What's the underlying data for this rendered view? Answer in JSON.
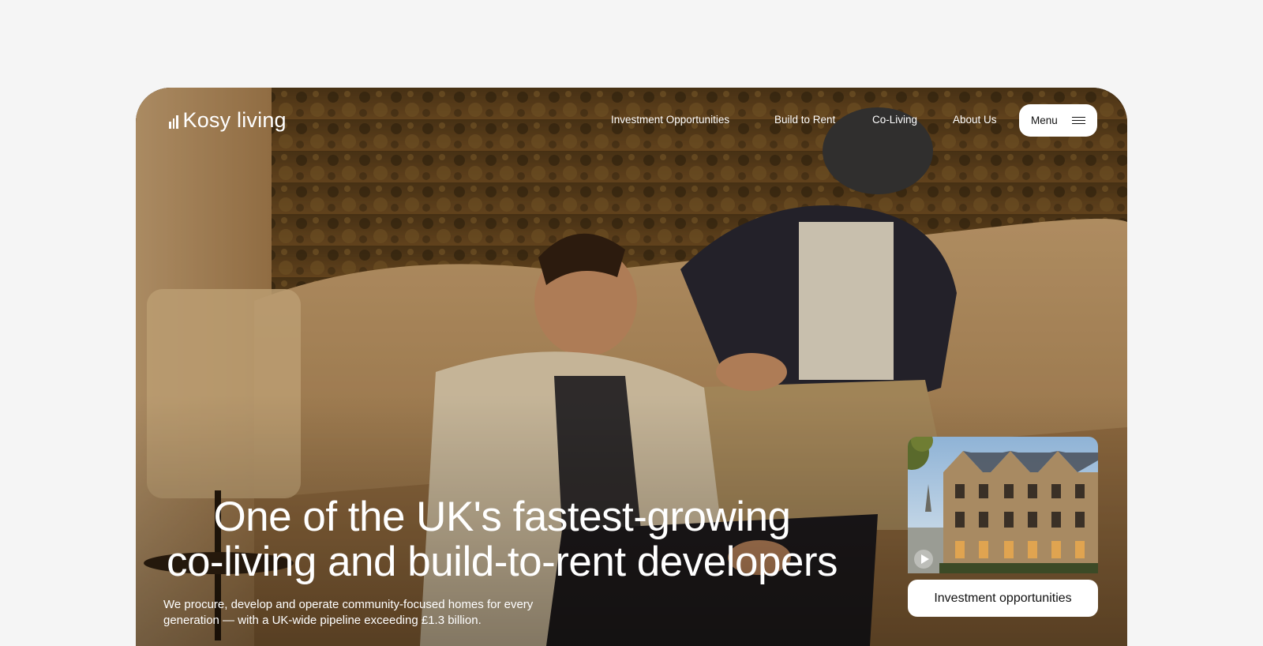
{
  "brand": {
    "name": "Kosy living"
  },
  "nav": {
    "items": [
      {
        "label": "Investment Opportunities"
      },
      {
        "label": "Build to Rent"
      },
      {
        "label": "Co-Living"
      },
      {
        "label": "About Us"
      }
    ],
    "menu_label": "Menu"
  },
  "hero": {
    "headline_line1": "One of the UK's fastest-growing",
    "headline_line2": "co-living and build-to-rent developers",
    "subtext_line1": "We procure, develop and operate community-focused homes for every",
    "subtext_line2": "generation — with a UK-wide pipeline exceeding £1.3 billion."
  },
  "card": {
    "button_label": "Investment opportunities"
  },
  "icons": {
    "logo": "signal-bars-icon",
    "menu": "hamburger-icon",
    "play": "play-icon"
  },
  "colors": {
    "page_bg": "#f5f5f5",
    "text_on_hero": "#ffffff",
    "button_bg": "#ffffff",
    "button_text": "#111111"
  }
}
